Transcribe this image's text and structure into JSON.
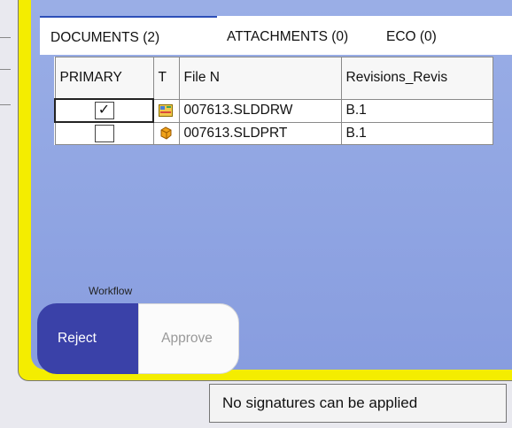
{
  "tabs": [
    {
      "label": "DOCUMENTS (2)",
      "active": true
    },
    {
      "label": "ATTACHMENTS (0)",
      "active": false
    },
    {
      "label": "ECO (0)",
      "active": false
    }
  ],
  "table": {
    "columns": [
      "PRIMARY",
      "T",
      "File N",
      "Revisions_Revis"
    ],
    "rows": [
      {
        "primary": true,
        "type_icon": "drawing-icon",
        "file": "007613.SLDDRW",
        "revision": "B.1"
      },
      {
        "primary": false,
        "type_icon": "part-icon",
        "file": "007613.SLDPRT",
        "revision": "B.1"
      }
    ]
  },
  "workflow": {
    "label": "Workflow",
    "reject_label": "Reject",
    "approve_label": "Approve"
  },
  "tooltip": "No signatures can be applied",
  "colors": {
    "frame": "#f4ed00",
    "panel": "#96aae5",
    "reject_bg": "#3a41a8",
    "approve_text": "#999999"
  }
}
